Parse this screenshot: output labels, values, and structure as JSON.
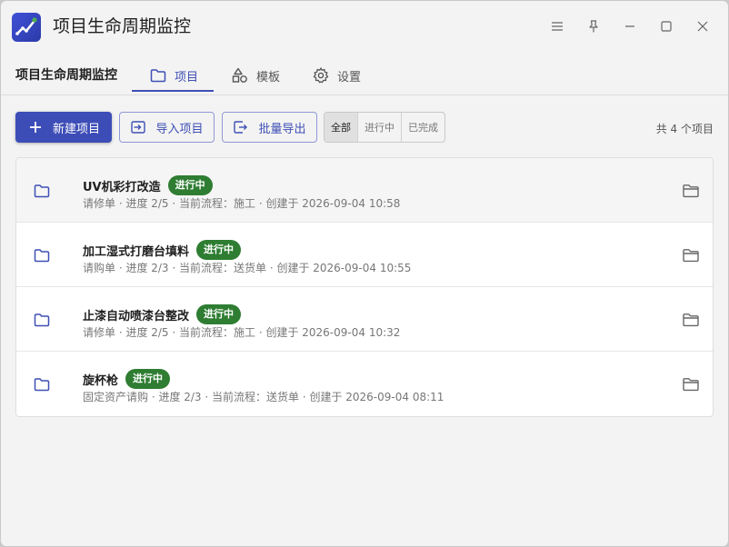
{
  "window": {
    "title": "项目生命周期监控"
  },
  "nav": {
    "brand": "项目生命周期监控",
    "tabs": [
      {
        "label": "项目",
        "active": true
      },
      {
        "label": "模板",
        "active": false
      },
      {
        "label": "设置",
        "active": false
      }
    ]
  },
  "toolbar": {
    "new_label": "新建项目",
    "import_label": "导入项目",
    "export_label": "批量导出",
    "filters": [
      {
        "label": "全部",
        "active": true
      },
      {
        "label": "进行中",
        "active": false
      },
      {
        "label": "已完成",
        "active": false
      }
    ],
    "count_text": "共 4 个项目"
  },
  "projects": [
    {
      "name": "UV机彩打改造",
      "status": "进行中",
      "meta": "请修单 · 进度 2/5 · 当前流程：施工 · 创建于 2026-09-04 10:58"
    },
    {
      "name": "加工湿式打磨台填料",
      "status": "进行中",
      "meta": "请购单 · 进度 2/3 · 当前流程：送货单 · 创建于 2026-09-04 10:55"
    },
    {
      "name": "止漆自动喷漆台整改",
      "status": "进行中",
      "meta": "请修单 · 进度 2/5 · 当前流程：施工 · 创建于 2026-09-04 10:32"
    },
    {
      "name": "旋杯枪",
      "status": "进行中",
      "meta": "固定资产请购 · 进度 2/3 · 当前流程：送货单 · 创建于 2026-09-04 08:11"
    }
  ],
  "colors": {
    "accent": "#3e4fb4",
    "status_active": "#2e7d32"
  }
}
